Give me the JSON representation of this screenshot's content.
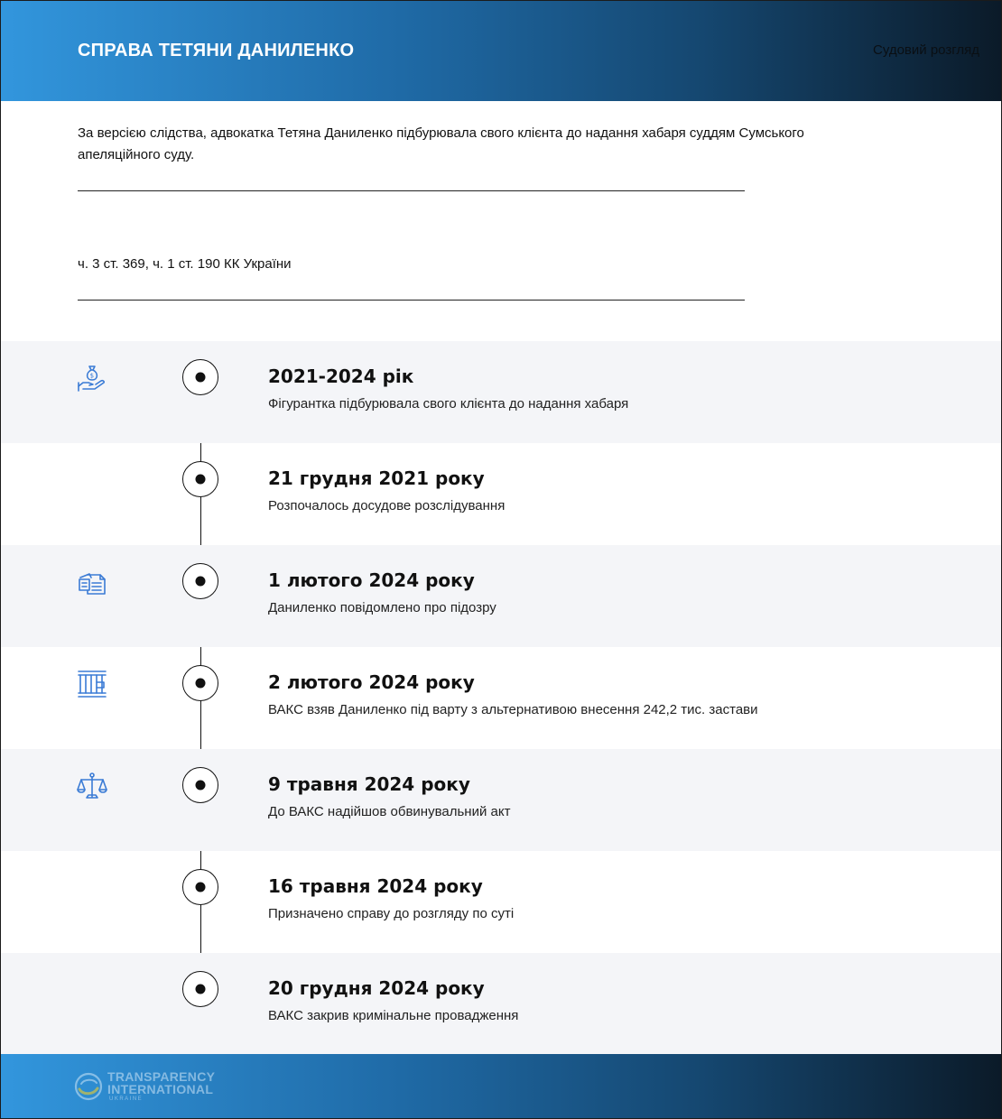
{
  "header": {
    "title": "СПРАВА ТЕТЯНИ ДАНИЛЕНКО",
    "tag": "Судовий розгляд"
  },
  "intro": {
    "text": "За версією слідства, адвокатка Тетяна Даниленко підбурювала свого клієнта до надання хабаря суддям Сумського апеляційного суду.",
    "articles": "ч. 3 ст. 369, ч. 1 ст. 190 КК України"
  },
  "timeline": [
    {
      "date": "2021-2024 рік",
      "description": "Фігурантка підбурювала свого клієнта до надання хабаря",
      "icon": "money-bag-hand-icon"
    },
    {
      "date": "21 грудня 2021 року",
      "description": "Розпочалось досудове розслідування",
      "icon": ""
    },
    {
      "date": "1 лютого 2024 року",
      "description": "Даниленко повідомлено про підозру",
      "icon": "documents-icon"
    },
    {
      "date": "2 лютого 2024 року",
      "description": "ВАКС взяв Даниленко під варту з альтернативою внесення 242,2 тис. застави",
      "icon": "prison-bars-icon"
    },
    {
      "date": "9 травня 2024 року",
      "description": "До ВАКС надійшов обвинувальний акт",
      "icon": "scales-icon"
    },
    {
      "date": "16 травня 2024 року",
      "description": "Призначено справу до розгляду по суті",
      "icon": ""
    },
    {
      "date": "20 грудня 2024 року",
      "description": "ВАКС закрив кримінальне провадження",
      "icon": ""
    }
  ],
  "footer": {
    "logo_line1": "TRANSPARENCY",
    "logo_line2": "INTERNATIONAL",
    "logo_sub": "UKRAINE"
  },
  "colors": {
    "accent_blue": "#3296dd",
    "header_dark": "#0b1a28",
    "icon_blue": "#3a7bd5",
    "row_shade": "#f4f5f8"
  }
}
